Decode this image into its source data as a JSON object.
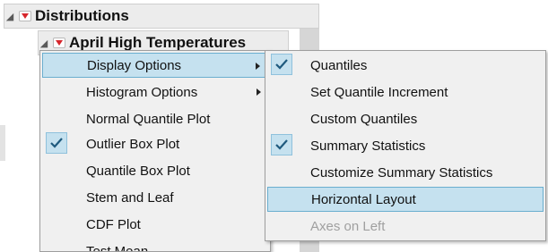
{
  "report": {
    "distributions_title": "Distributions",
    "april_title": "April High Temperatures"
  },
  "left_menu": {
    "items": [
      {
        "label": "Display Options",
        "checked": false,
        "submenu": true,
        "highlighted": true
      },
      {
        "label": "Histogram Options",
        "checked": false,
        "submenu": true
      },
      {
        "label": "Normal Quantile Plot",
        "checked": false
      },
      {
        "label": "Outlier Box Plot",
        "checked": true
      },
      {
        "label": "Quantile Box Plot",
        "checked": false
      },
      {
        "label": "Stem and Leaf",
        "checked": false
      },
      {
        "label": "CDF Plot",
        "checked": false
      },
      {
        "label": "Test Mean",
        "checked": false
      }
    ]
  },
  "right_menu": {
    "items": [
      {
        "label": "Quantiles",
        "checked": true
      },
      {
        "label": "Set Quantile Increment",
        "checked": false
      },
      {
        "label": "Custom Quantiles",
        "checked": false
      },
      {
        "label": "Summary Statistics",
        "checked": true
      },
      {
        "label": "Customize Summary Statistics",
        "checked": false
      },
      {
        "label": "Horizontal Layout",
        "checked": false,
        "highlighted": true
      },
      {
        "label": "Axes on Left",
        "checked": false,
        "disabled": true
      }
    ]
  },
  "colors": {
    "highlight": "#c5e1ef",
    "highlight_border": "#6aaecf",
    "red_triangle": "#d6252b",
    "menu_bg": "#f0f0f0"
  },
  "icons": {
    "disclosure": "collapse-triangle-icon",
    "red_menu": "red-triangle-menu-icon",
    "check": "checkmark-icon",
    "submenu": "submenu-arrow-icon"
  }
}
